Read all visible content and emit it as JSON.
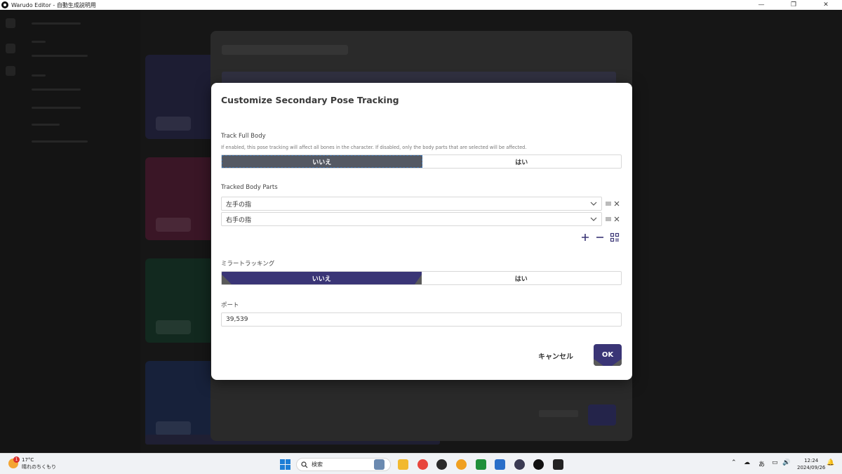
{
  "window": {
    "title": "Warudo Editor - 自動生成説明用",
    "minimize": "—",
    "restore": "❐",
    "close": "✕"
  },
  "dialog": {
    "title": "Customize Secondary Pose Tracking",
    "track_full_body": {
      "label": "Track Full Body",
      "description": "If enabled, this pose tracking will affect all bones in the character. If disabled, only the body parts that are selected will be affected.",
      "option_no": "いいえ",
      "option_yes": "はい",
      "selected": "いいえ"
    },
    "tracked_body_parts": {
      "label": "Tracked Body Parts",
      "items": [
        {
          "value": "左手の指"
        },
        {
          "value": "右手の指"
        }
      ]
    },
    "mirror_tracking": {
      "label": "ミラートラッキング",
      "option_no": "いいえ",
      "option_yes": "はい",
      "selected": "いいえ"
    },
    "port": {
      "label": "ポート",
      "value": "39,539"
    },
    "cancel_label": "キャンセル",
    "ok_label": "OK"
  },
  "taskbar": {
    "weather_temp": "17°C",
    "weather_desc": "晴れのちくもり",
    "weather_badge": "1",
    "search_placeholder": "検索",
    "ime_label": "あ",
    "time": "12:24",
    "date": "2024/09/26"
  },
  "colors": {
    "accent_purple": "#3a3576",
    "toggle_gray": "#555963"
  }
}
